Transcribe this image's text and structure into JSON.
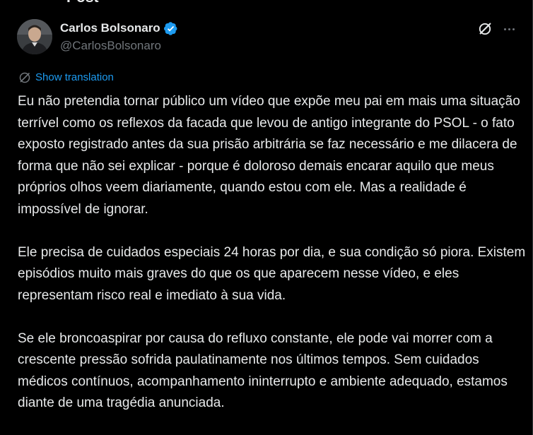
{
  "page": {
    "heading": "Post"
  },
  "author": {
    "name": "Carlos Bolsonaro",
    "handle": "@CarlosBolsonaro",
    "verified": true
  },
  "actions": {
    "grok_icon": "grok-icon",
    "more_icon": "more-horizontal-icon"
  },
  "translation": {
    "label": "Show translation",
    "icon": "translate-icon"
  },
  "post": {
    "paragraphs": [
      "Eu não pretendia tornar público um vídeo que expõe meu pai em mais uma situação terrível como os reflexos da facada que levou de antigo integrante do PSOL - o fato exposto registrado antes da sua prisão arbitrária se faz necessário e me dilacera de forma que não sei explicar - porque é doloroso demais encarar aquilo que meus próprios olhos veem diariamente, quando estou com ele. Mas a realidade é impossível de ignorar.",
      "Ele precisa de cuidados especiais 24 horas por dia, e sua condição só piora. Existem episódios muito mais graves do que os que aparecem nesse vídeo, e eles representam risco real e imediato à sua vida.",
      "Se ele broncoaspirar por causa do refluxo constante, ele pode  vai morrer com a crescente pressão sofrida paulatinamente nos últimos tempos. Sem cuidados médicos contínuos, acompanhamento ininterrupto e ambiente adequado, estamos diante de uma tragédia anunciada."
    ]
  },
  "colors": {
    "background": "#000000",
    "text": "#e7e9ea",
    "secondary": "#71767b",
    "accent": "#1d9bf0"
  }
}
